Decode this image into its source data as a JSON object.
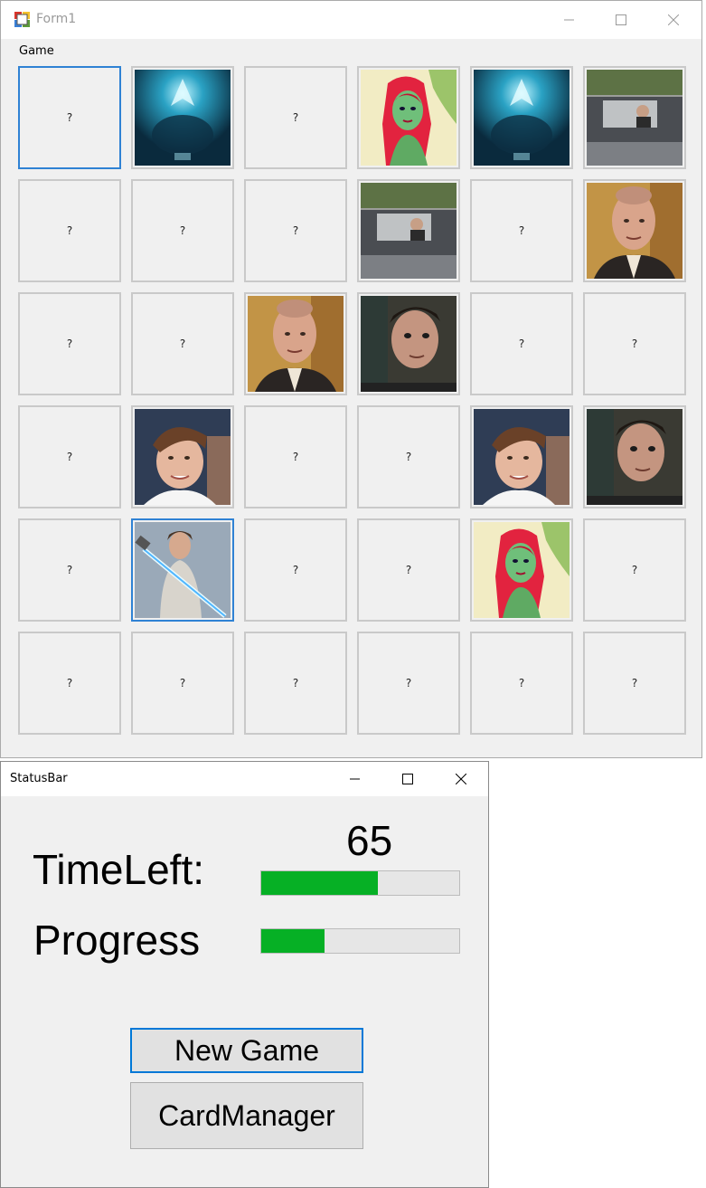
{
  "form1": {
    "title": "Form1",
    "menu": [
      "Game"
    ],
    "hidden_card_label": "?",
    "grid": [
      [
        "hidden",
        "spiral",
        "hidden",
        "ivy",
        "spiral",
        "car"
      ],
      [
        "hidden",
        "hidden",
        "hidden",
        "car",
        "hidden",
        "man"
      ],
      [
        "hidden",
        "hidden",
        "man",
        "boy",
        "hidden",
        "hidden"
      ],
      [
        "hidden",
        "kid",
        "hidden",
        "hidden",
        "kid",
        "boy"
      ],
      [
        "hidden",
        "jedi",
        "hidden",
        "hidden",
        "ivy",
        "hidden"
      ],
      [
        "hidden",
        "hidden",
        "hidden",
        "hidden",
        "hidden",
        "hidden"
      ]
    ],
    "focused_cards": [
      [
        0,
        0
      ],
      [
        4,
        1
      ]
    ]
  },
  "statusbar": {
    "title": "StatusBar",
    "time_left_label": "TimeLeft:",
    "progress_label": "Progress",
    "time_left_value": "65",
    "time_left_fraction": 0.59,
    "progress_fraction": 0.32,
    "new_game_label": "New Game",
    "card_manager_label": "CardManager",
    "accent": "#0078d7",
    "progress_color": "#06b025"
  },
  "icons": [
    "app-icon",
    "minimize-icon",
    "maximize-icon",
    "close-icon"
  ]
}
